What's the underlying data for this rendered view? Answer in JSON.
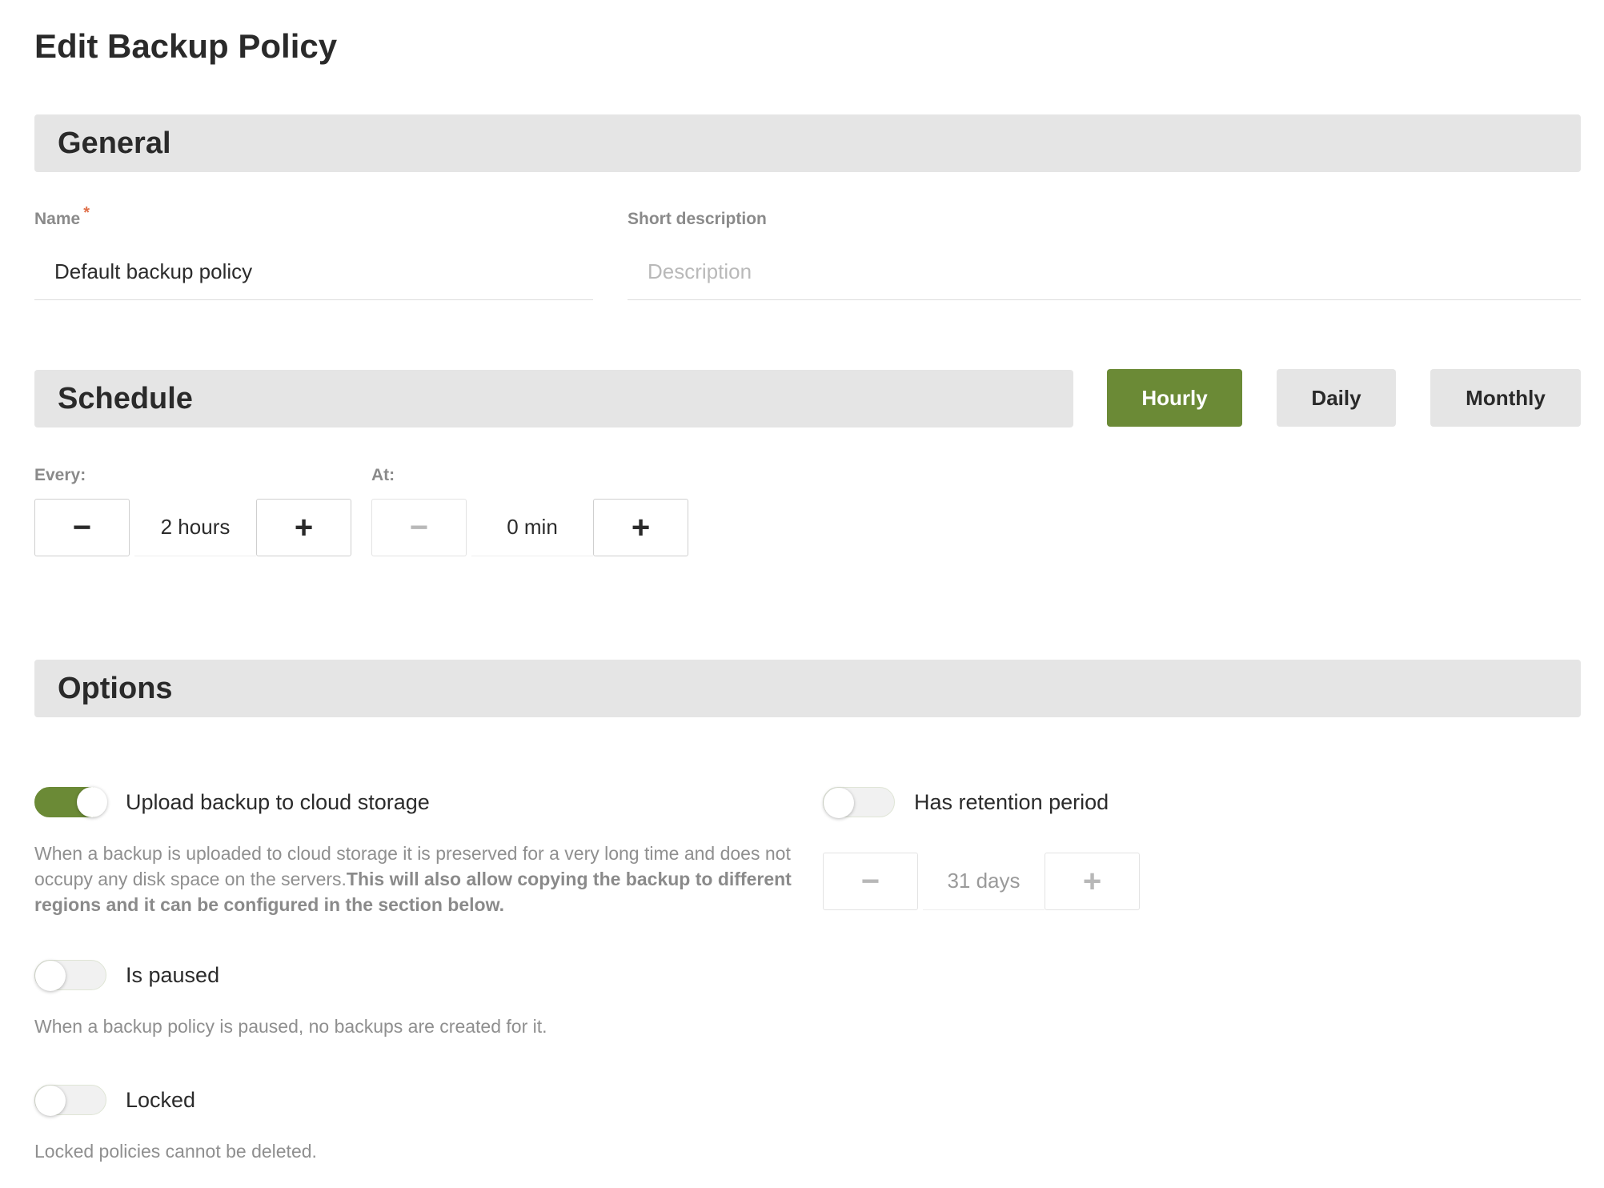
{
  "page": {
    "title": "Edit Backup Policy"
  },
  "general": {
    "section_title": "General",
    "name_label": "Name",
    "required_marker": "*",
    "name_value": "Default backup policy",
    "description_label": "Short description",
    "description_placeholder": "Description",
    "description_value": ""
  },
  "schedule": {
    "section_title": "Schedule",
    "frequencies": [
      {
        "label": "Hourly",
        "selected": true
      },
      {
        "label": "Daily",
        "selected": false
      },
      {
        "label": "Monthly",
        "selected": false
      }
    ],
    "every_label": "Every:",
    "every_value": "2 hours",
    "at_label": "At:",
    "at_value": "0 min",
    "minus_glyph": "−",
    "plus_glyph": "+"
  },
  "options": {
    "section_title": "Options",
    "upload": {
      "label": "Upload backup to cloud storage",
      "enabled": true,
      "help_plain": "When a backup is uploaded to cloud storage it is preserved for a very long time and does not occupy any disk space on the servers.",
      "help_bold": "This will also allow copying the backup to different regions and it can be configured in the section below."
    },
    "retention": {
      "label": "Has retention period",
      "enabled": false,
      "value": "31 days"
    },
    "paused": {
      "label": "Is paused",
      "enabled": false,
      "help": "When a backup policy is paused, no backups are created for it."
    },
    "locked": {
      "label": "Locked",
      "enabled": false,
      "help": "Locked policies cannot be deleted."
    }
  },
  "colors": {
    "accent": "#6b8a36",
    "section_bg": "#e5e5e5",
    "required": "#e0704a"
  }
}
